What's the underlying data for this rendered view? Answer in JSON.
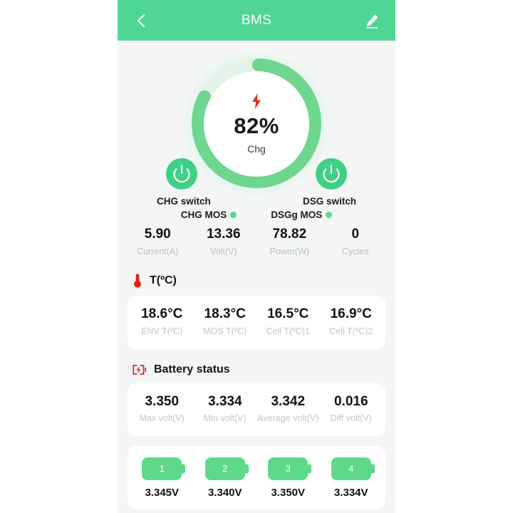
{
  "theme": {
    "header_green": "#4fd694",
    "accent_green": "#5ed98c",
    "bolt_red": "#e03020",
    "page_bg": "#f4f6f6",
    "card_bg": "#ffffff",
    "label_gray": "#bbbfbf"
  },
  "header": {
    "title": "BMS",
    "back_icon": "chevron-left-icon",
    "edit_icon": "pencil-icon"
  },
  "gauge": {
    "percent_label": "82%",
    "percent_value": 82,
    "state_label": "Chg",
    "charging_icon": "lightning-bolt-icon"
  },
  "switches": [
    {
      "name": "chg",
      "label": "CHG switch",
      "icon": "power-icon"
    },
    {
      "name": "dsg",
      "label": "DSG switch",
      "icon": "power-icon"
    }
  ],
  "mos_status": [
    {
      "label": "CHG MOS",
      "state_color": "#5ed98c"
    },
    {
      "label": "DSGg MOS",
      "state_color": "#5ed98c"
    }
  ],
  "stats": [
    {
      "value": "5.90",
      "label": "Current(A)"
    },
    {
      "value": "13.36",
      "label": "Volt(V)"
    },
    {
      "value": "78.82",
      "label": "Power(W)"
    },
    {
      "value": "0",
      "label": "Cycles"
    }
  ],
  "temperature": {
    "section_title": "T(ºC)",
    "section_icon": "thermometer-icon",
    "items": [
      {
        "value": "18.6°C",
        "label": "ENV T(ºC)"
      },
      {
        "value": "18.3°C",
        "label": "MOS T(ºC)"
      },
      {
        "value": "16.5°C",
        "label": "Cell T(ºC)1"
      },
      {
        "value": "16.9°C",
        "label": "Cell T(ºC)2"
      }
    ]
  },
  "battery_status": {
    "section_title": "Battery status",
    "section_icon": "battery-bolt-icon",
    "items": [
      {
        "value": "3.350",
        "label": "Max volt(V)"
      },
      {
        "value": "3.334",
        "label": "Min volt(V)"
      },
      {
        "value": "3.342",
        "label": "Average volt(V)"
      },
      {
        "value": "0.016",
        "label": "Diff volt(V)"
      }
    ]
  },
  "cells": [
    {
      "index": "1",
      "voltage": "3.345V"
    },
    {
      "index": "2",
      "voltage": "3.340V"
    },
    {
      "index": "3",
      "voltage": "3.350V"
    },
    {
      "index": "4",
      "voltage": "3.334V"
    }
  ]
}
